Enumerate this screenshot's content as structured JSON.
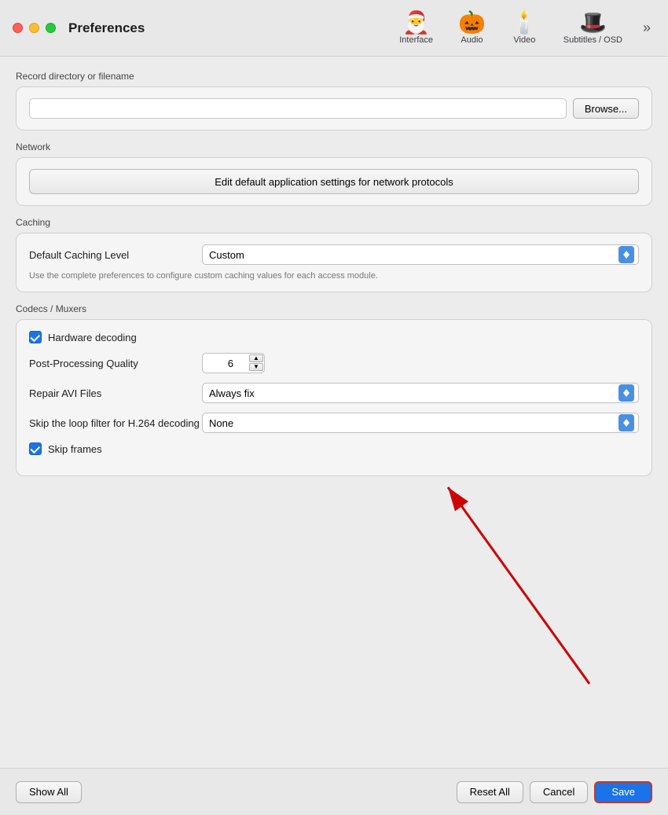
{
  "window": {
    "title": "Preferences"
  },
  "toolbar": {
    "tabs": [
      {
        "id": "interface",
        "label": "Interface",
        "icon": "🎅"
      },
      {
        "id": "audio",
        "label": "Audio",
        "icon": "🎃"
      },
      {
        "id": "video",
        "label": "Video",
        "icon": "🕯️"
      },
      {
        "id": "subtitles",
        "label": "Subtitles / OSD",
        "icon": "🎩"
      }
    ],
    "more": "»"
  },
  "sections": {
    "record": {
      "label": "Record directory or filename",
      "input_value": "",
      "input_placeholder": "",
      "browse_label": "Browse..."
    },
    "network": {
      "label": "Network",
      "button_label": "Edit default application settings for network protocols"
    },
    "caching": {
      "label": "Caching",
      "default_caching_level_label": "Default Caching Level",
      "default_caching_value": "Custom",
      "hint": "Use the complete preferences to configure custom caching values for each access module."
    },
    "codecs": {
      "label": "Codecs / Muxers",
      "hardware_decoding_label": "Hardware decoding",
      "hardware_decoding_checked": true,
      "post_processing_label": "Post-Processing Quality",
      "post_processing_value": "6",
      "repair_avi_label": "Repair AVI Files",
      "repair_avi_value": "Always fix",
      "skip_loop_label": "Skip the loop filter for H.264 decoding",
      "skip_loop_value": "None",
      "skip_frames_label": "Skip frames",
      "skip_frames_checked": true
    }
  },
  "bottom_bar": {
    "show_all": "Show All",
    "reset_all": "Reset All",
    "cancel": "Cancel",
    "save": "Save"
  }
}
